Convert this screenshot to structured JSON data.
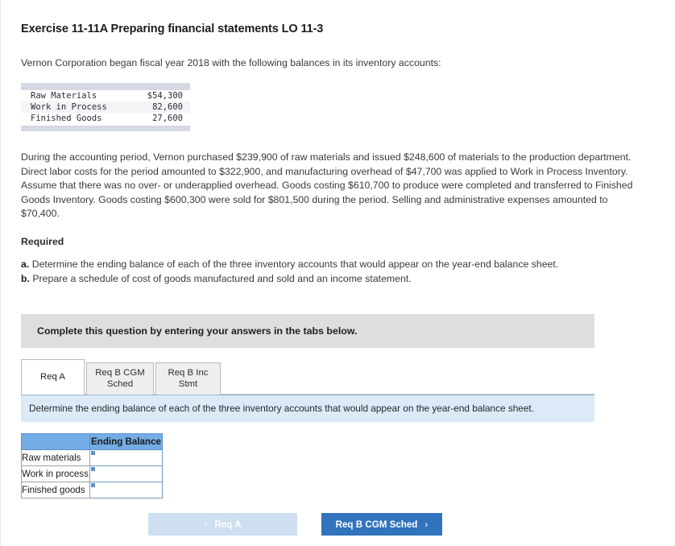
{
  "exercise": {
    "title": "Exercise 11-11A Preparing financial statements LO 11-3",
    "intro": "Vernon Corporation began fiscal year 2018 with the following balances in its inventory accounts:"
  },
  "balances": {
    "rows": [
      {
        "account": "Raw Materials",
        "amount": "$54,300"
      },
      {
        "account": "Work in Process",
        "amount": "82,600"
      },
      {
        "account": "Finished Goods",
        "amount": "27,600"
      }
    ]
  },
  "body": {
    "paragraph": "During the accounting period, Vernon purchased $239,900 of raw materials and issued $248,600 of materials to the production department. Direct labor costs for the period amounted to $322,900, and manufacturing overhead of $47,700 was applied to Work in Process Inventory. Assume that there was no over- or underapplied overhead. Goods costing $610,700 to produce were completed and transferred to Finished Goods Inventory. Goods costing $600,300 were sold for $801,500 during the period. Selling and administrative expenses amounted to $70,400."
  },
  "required": {
    "heading": "Required",
    "items": [
      {
        "marker": "a.",
        "text": "Determine the ending balance of each of the three inventory accounts that would appear on the year-end balance sheet."
      },
      {
        "marker": "b.",
        "text": "Prepare a schedule of cost of goods manufactured and sold and an income statement."
      }
    ]
  },
  "banner": {
    "text": "Complete this question by entering your answers in the tabs below."
  },
  "tabs": [
    {
      "label": "Req A",
      "active": true
    },
    {
      "label": "Req B CGM Sched",
      "line1": "Req B CGM",
      "line2": "Sched",
      "active": false
    },
    {
      "label": "Req B Inc Stmt",
      "line1": "Req B Inc",
      "line2": "Stmt",
      "active": false
    }
  ],
  "instruction": {
    "text": "Determine the ending balance of each of the three inventory accounts that would appear on the year-end balance sheet."
  },
  "answer_table": {
    "header_blank": "",
    "header_value": "Ending Balance",
    "rows": [
      {
        "label": "Raw materials",
        "value": ""
      },
      {
        "label": "Work in process",
        "value": ""
      },
      {
        "label": "Finished goods",
        "value": ""
      }
    ]
  },
  "nav": {
    "prev_label": "Req A",
    "prev_chevron": "‹",
    "next_label": "Req B CGM Sched",
    "next_chevron": "›"
  },
  "colors": {
    "primary_button": "#3273bd",
    "disabled_button": "#cddff0",
    "table_header": "#74ade5",
    "instruction_bar": "#dceaf7",
    "banner_gray": "#dededf"
  }
}
